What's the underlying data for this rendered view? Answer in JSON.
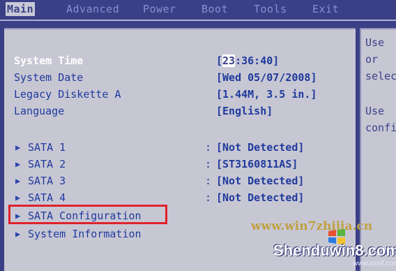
{
  "menu": {
    "tabs": [
      "Main",
      "Advanced",
      "Power",
      "Boot",
      "Tools",
      "Exit"
    ],
    "active": "Main"
  },
  "main": {
    "system_time_label": "System Time",
    "system_time_value_hl": "23",
    "system_time_value_rest": ":36:40]",
    "system_time_open": "[",
    "system_date_label": "System Date",
    "system_date_value": "[Wed 05/07/2008]",
    "legacy_diskette_label": "Legacy Diskette A",
    "legacy_diskette_value": "[1.44M, 3.5 in.]",
    "language_label": "Language",
    "language_value": "[English]",
    "sata": [
      {
        "label": "SATA 1",
        "value": "[Not Detected]"
      },
      {
        "label": "SATA 2",
        "value": "[ST3160811AS]"
      },
      {
        "label": "SATA 3",
        "value": "[Not Detected]"
      },
      {
        "label": "SATA 4",
        "value": "[Not Detected]"
      }
    ],
    "sata_configuration_label": "SATA Configuration",
    "system_information_label": "System Information"
  },
  "help": {
    "lines": [
      "Use",
      "or",
      "selec",
      "Use",
      "confi"
    ]
  },
  "watermark": {
    "line1": "www.win7zhijia.cn",
    "line2": "Shenduwin8.com",
    "line3": "www.xxinf.com"
  },
  "colors": {
    "background": "#3a3f86",
    "panel": "#c7c7d4",
    "text": "#1f3a9c",
    "highlight_box": "#e0222b"
  }
}
